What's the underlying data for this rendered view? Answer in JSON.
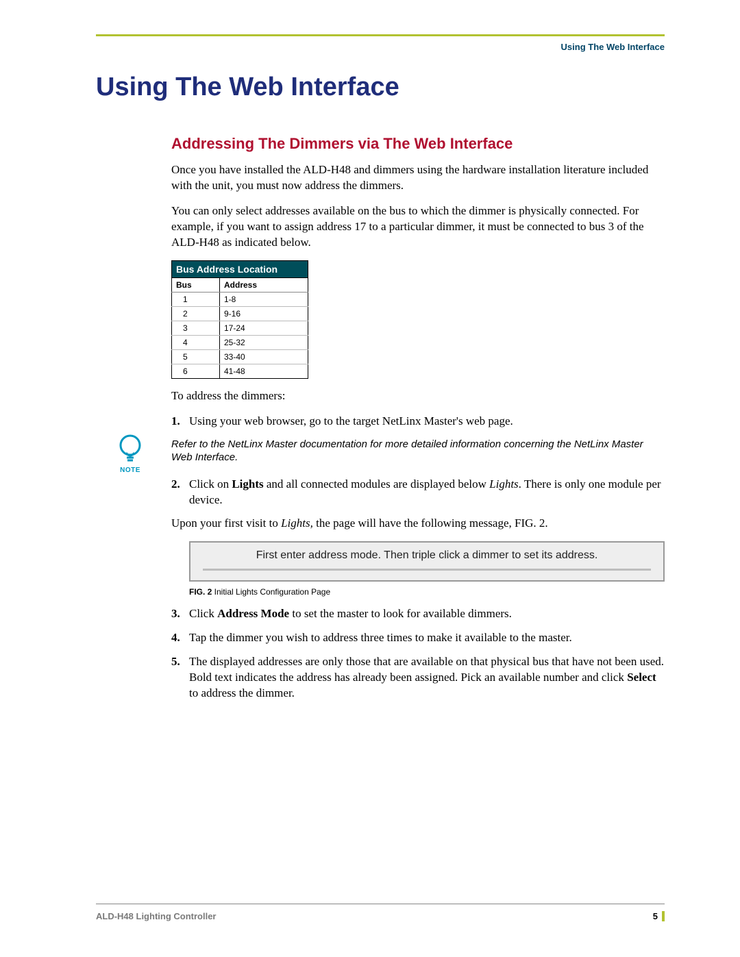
{
  "header": {
    "running_head": "Using The Web Interface"
  },
  "title": "Using The Web Interface",
  "section": {
    "heading": "Addressing The Dimmers via The Web Interface",
    "para1": "Once you have installed the ALD-H48 and dimmers using the hardware installation literature included with the unit, you must now address the dimmers.",
    "para2": "You can only select addresses available on the bus to which the dimmer is physically connected. For example, if you want to assign address 17 to a particular dimmer, it must be connected to bus 3 of the ALD-H48 as indicated below.",
    "lead_in": "To address the dimmers:",
    "upon_visit": "Upon your first visit to ",
    "upon_visit_em": "Lights,",
    "upon_visit_tail": " the page will have the following message, FIG. 2."
  },
  "table": {
    "title": "Bus Address Location",
    "col_bus": "Bus",
    "col_addr": "Address",
    "rows": [
      {
        "bus": "1",
        "addr": "1-8"
      },
      {
        "bus": "2",
        "addr": "9-16"
      },
      {
        "bus": "3",
        "addr": "17-24"
      },
      {
        "bus": "4",
        "addr": "25-32"
      },
      {
        "bus": "5",
        "addr": "33-40"
      },
      {
        "bus": "6",
        "addr": "41-48"
      }
    ]
  },
  "steps": {
    "s1_num": "1.",
    "s1_text": "Using your web browser, go to the target NetLinx Master's web page.",
    "note_label": "NOTE",
    "note_text": "Refer to the NetLinx Master documentation for more detailed information concerning the NetLinx Master Web Interface.",
    "s2_num": "2.",
    "s2_a": "Click on ",
    "s2_b": "Lights",
    "s2_c": " and all connected modules are displayed below ",
    "s2_d": "Lights",
    "s2_e": ". There is only one module per device.",
    "s3_num": "3.",
    "s3_a": "Click ",
    "s3_b": "Address Mode",
    "s3_c": " to set the master to look for available dimmers.",
    "s4_num": "4.",
    "s4_text": "Tap the dimmer you wish to address three times to make it available to the master.",
    "s5_num": "5.",
    "s5_a": "The displayed addresses are only those that are available on that physical bus that have not been used. Bold text indicates the address has already been assigned. Pick an available number and click ",
    "s5_b": "Select",
    "s5_c": " to address the dimmer."
  },
  "figure": {
    "message": "First enter address mode. Then triple click a dimmer to set its address.",
    "caption_tag": "FIG. 2",
    "caption_text": "  Initial Lights Configuration Page"
  },
  "footer": {
    "doc_title": "ALD-H48 Lighting Controller",
    "page_num": "5"
  }
}
